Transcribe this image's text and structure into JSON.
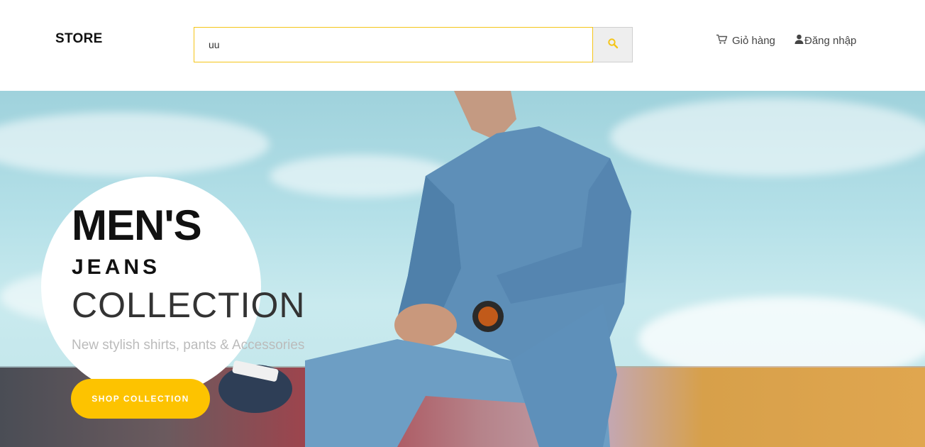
{
  "header": {
    "logo": "STORE",
    "search": {
      "value": "uu",
      "placeholder": ""
    },
    "nav": {
      "cart_label": "Giỏ hàng",
      "login_label": "Đăng nhập"
    }
  },
  "hero": {
    "title_line1": "MEN'S",
    "title_line2": "JEANS",
    "title_line3": "COLLECTION",
    "subtitle": "New stylish shirts, pants & Accessories",
    "cta_label": "SHOP COLLECTION"
  },
  "colors": {
    "accent": "#fdc300",
    "search_border": "#f5c518",
    "sky": "#b4e0e8"
  },
  "icons": {
    "search": "search-icon",
    "cart": "cart-icon",
    "user": "user-icon"
  }
}
